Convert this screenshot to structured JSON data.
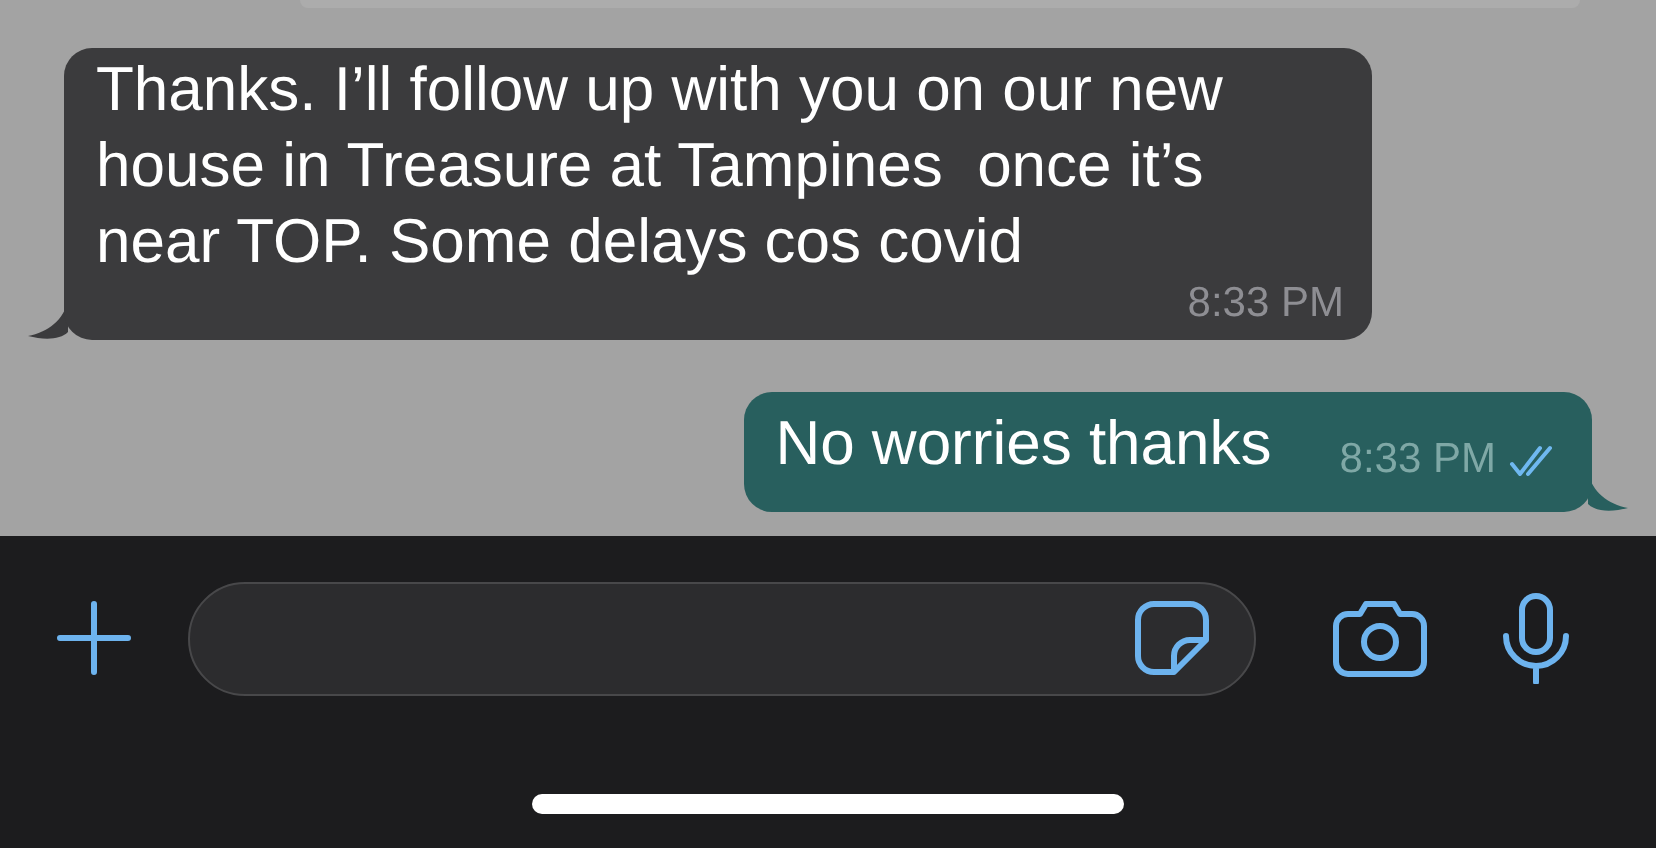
{
  "messages": [
    {
      "kind": "incoming",
      "text": "Thanks. I’ll follow up with you on our new house in Treasure at Tampines  once it’s near TOP. Some delays cos covid",
      "time": "8:33 PM"
    },
    {
      "kind": "outgoing",
      "text": "No worries thanks",
      "time": "8:33 PM",
      "read": true
    }
  ]
}
